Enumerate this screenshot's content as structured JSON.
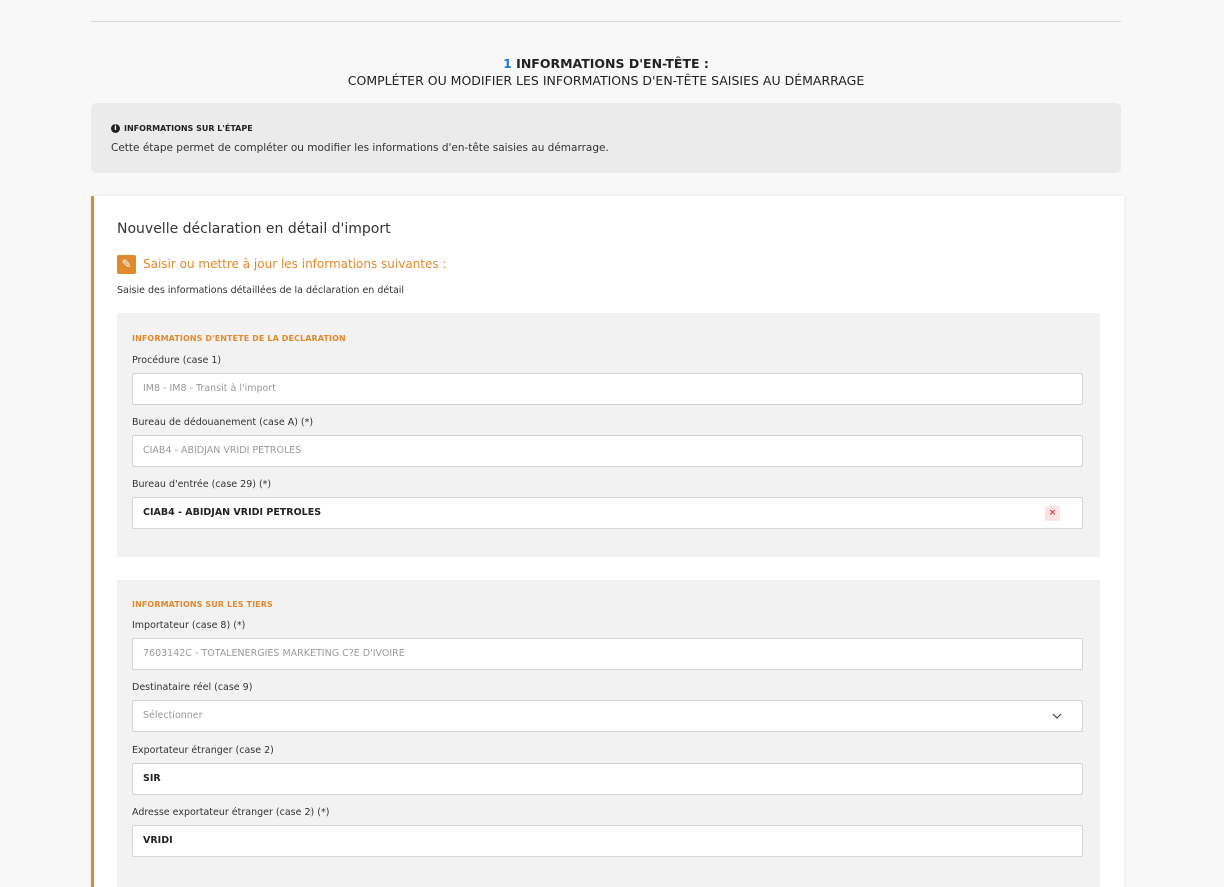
{
  "step": {
    "number": "1",
    "title": "INFORMATIONS D'EN-TÊTE :",
    "subtitle": "COMPLÉTER OU MODIFIER LES INFORMATIONS D'EN-TÊTE SAISIES AU DÉMARRAGE"
  },
  "info": {
    "heading": "INFORMATIONS SUR L'ÉTAPE",
    "text": "Cette étape permet de compléter ou modifier les informations d'en-tête saisies au démarrage."
  },
  "card": {
    "title": "Nouvelle déclaration en détail d'import",
    "edit_label": "Saisir ou mettre à jour les informations suivantes :",
    "subtitle": "Saisie des informations détaillées de la déclaration en détail"
  },
  "section_header": {
    "title": "INFORMATIONS D'ENTETE DE LA DECLARATION",
    "fields": [
      {
        "label": "Procédure (case 1)",
        "value": "IM8 - IM8 - Transit à l'import"
      },
      {
        "label": "Bureau de dédouanement (case A) (*)",
        "value": "CIAB4 - ABIDJAN VRIDI PETROLES"
      },
      {
        "label": "Bureau d'entrée (case 29) (*)",
        "value": "CIAB4 - ABIDJAN VRIDI PETROLES",
        "clear": "×"
      }
    ]
  },
  "section_tiers": {
    "title": "INFORMATIONS SUR LES TIERS",
    "fields": [
      {
        "label": "Importateur (case 8) (*)",
        "value": "7603142C - TOTALENERGIES MARKETING C?E D'IVOIRE"
      },
      {
        "label": "Destinataire réel (case 9)",
        "placeholder": "Sélectionner"
      },
      {
        "label": "Exportateur étranger (case 2)",
        "value": "SIR"
      },
      {
        "label": "Adresse exportateur étranger (case 2) (*)",
        "value": "VRIDI"
      }
    ]
  },
  "colors": {
    "accent": "#e08a2e",
    "step_number": "#1e7cd2",
    "clear": "#dd3333"
  }
}
